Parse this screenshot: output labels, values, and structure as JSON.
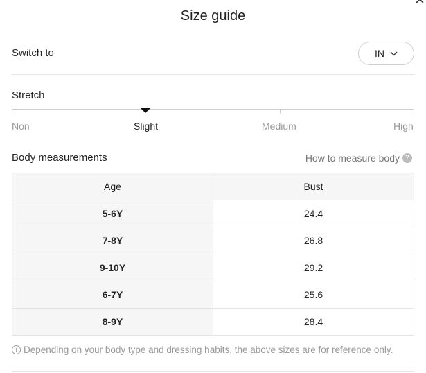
{
  "dialog": {
    "title": "Size guide"
  },
  "switch": {
    "label": "Switch to",
    "unit": "IN"
  },
  "stretch": {
    "title": "Stretch",
    "levels": [
      "Non",
      "Slight",
      "Medium",
      "High"
    ],
    "selected": "Slight"
  },
  "body_measurements": {
    "title": "Body measurements",
    "how_to_link": "How to measure body",
    "help_glyph": "?",
    "columns": [
      "Age",
      "Bust"
    ],
    "rows": [
      {
        "age": "5-6Y",
        "bust": "24.4"
      },
      {
        "age": "7-8Y",
        "bust": "26.8"
      },
      {
        "age": "9-10Y",
        "bust": "29.2"
      },
      {
        "age": "6-7Y",
        "bust": "25.6"
      },
      {
        "age": "8-9Y",
        "bust": "28.4"
      }
    ]
  },
  "note": {
    "text": "Depending on your body type and dressing habits, the above sizes are for reference only.",
    "info_glyph": "i"
  },
  "icons": {
    "close": "close-icon",
    "chevron": "chevron-down-icon",
    "help": "help-icon",
    "info": "info-icon"
  }
}
